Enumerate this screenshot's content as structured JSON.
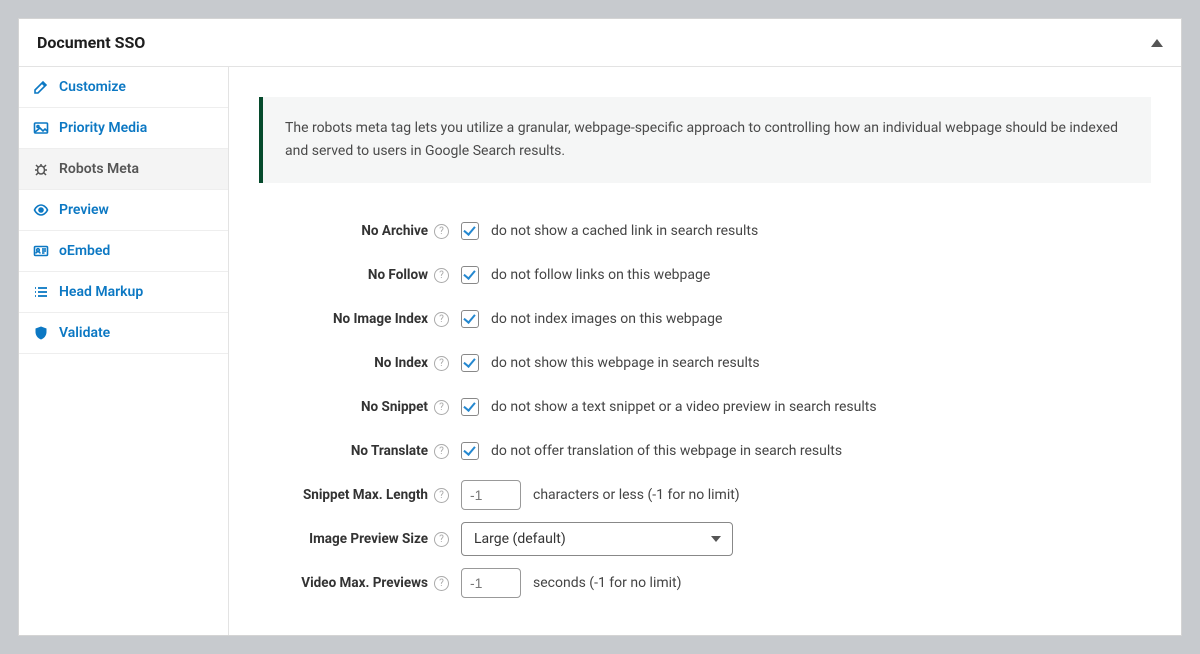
{
  "header": {
    "title": "Document SSO"
  },
  "sidebar": {
    "items": [
      {
        "label": "Customize",
        "icon": "edit-icon"
      },
      {
        "label": "Priority Media",
        "icon": "image-icon"
      },
      {
        "label": "Robots Meta",
        "icon": "bug-icon"
      },
      {
        "label": "Preview",
        "icon": "eye-icon"
      },
      {
        "label": "oEmbed",
        "icon": "id-card-icon"
      },
      {
        "label": "Head Markup",
        "icon": "list-icon"
      },
      {
        "label": "Validate",
        "icon": "shield-icon"
      }
    ],
    "activeIndex": 2
  },
  "info": "The robots meta tag lets you utilize a granular, webpage-specific approach to controlling how an individual webpage should be indexed and served to users in Google Search results.",
  "rows": {
    "noArchive": {
      "label": "No Archive",
      "checked": true,
      "desc": "do not show a cached link in search results"
    },
    "noFollow": {
      "label": "No Follow",
      "checked": true,
      "desc": "do not follow links on this webpage"
    },
    "noImageIndex": {
      "label": "No Image Index",
      "checked": true,
      "desc": "do not index images on this webpage"
    },
    "noIndex": {
      "label": "No Index",
      "checked": true,
      "desc": "do not show this webpage in search results"
    },
    "noSnippet": {
      "label": "No Snippet",
      "checked": true,
      "desc": "do not show a text snippet or a video preview in search results"
    },
    "noTranslate": {
      "label": "No Translate",
      "checked": true,
      "desc": "do not offer translation of this webpage in search results"
    },
    "snippetMax": {
      "label": "Snippet Max. Length",
      "value": "-1",
      "suffix": "characters or less (-1 for no limit)"
    },
    "imagePreview": {
      "label": "Image Preview Size",
      "selected": "Large (default)"
    },
    "videoMax": {
      "label": "Video Max. Previews",
      "value": "-1",
      "suffix": "seconds (-1 for no limit)"
    }
  }
}
